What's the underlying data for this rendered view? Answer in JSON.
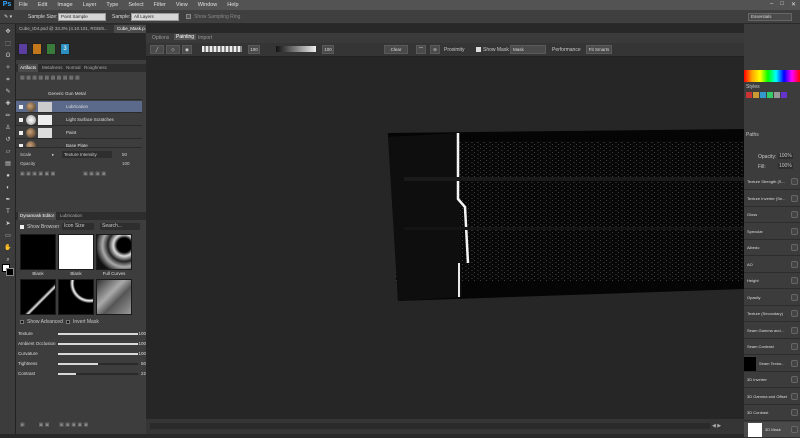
{
  "app": {
    "logo": "Ps"
  },
  "menu": [
    "File",
    "Edit",
    "Image",
    "Layer",
    "Type",
    "Select",
    "Filter",
    "View",
    "Window",
    "Help"
  ],
  "options": {
    "sample_size_label": "Sample Size:",
    "sample_size_value": "Point Sample",
    "sample_label": "Sample:",
    "sample_value": "All Layers",
    "show_ring": "Show Sampling Ring",
    "workspace": "Essentials"
  },
  "doc_tabs": [
    {
      "label": "Cube_ID4.psd @ 33.3% (4.10.101, RGB/8...",
      "active": false
    },
    {
      "label": "Cube_Mask.p...",
      "active": true
    }
  ],
  "ddo_top": {
    "tabs": [
      "Options",
      "Painting",
      "Import"
    ],
    "active": "Painting"
  },
  "ddo_bar": {
    "v1": "100",
    "v2": "100",
    "clear": "Clear",
    "proximity": "Proximity",
    "show_mask": "Show Mask",
    "mask": "Mask",
    "performance": "Performance",
    "fit_smarts": "Fit Smarts"
  },
  "left": {
    "tabs": [
      "Artifacts",
      "Metalness",
      "Normal",
      "Roughness"
    ],
    "layers": [
      {
        "label": "Generic Gun Metal"
      },
      {
        "label": "Lubrication"
      },
      {
        "label": "Light Surface Scratches"
      },
      {
        "label": "Paint"
      },
      {
        "label": "Base Plate"
      }
    ],
    "scale_label": "Scale",
    "scale_field": "Texture Intensity",
    "scale_val": "50",
    "opacity_label": "Opacity",
    "opacity_val": "100",
    "editor_tabs": [
      "Dynamask Editor",
      "Lubrication"
    ],
    "show_browser": "Show Browser",
    "icon_size": "Icon Size",
    "search": "Search...",
    "thumbs": [
      "Blank",
      "Blank",
      "Full Curves"
    ],
    "show_advanced": "Show Advanced",
    "invert_mask": "Invert Mask",
    "sliders": [
      {
        "label": "Texture",
        "value": 100,
        "display": "100"
      },
      {
        "label": "Ambient Occlusion",
        "value": 100,
        "display": "100"
      },
      {
        "label": "Curvature",
        "value": 100,
        "display": "100"
      },
      {
        "label": "Tightness",
        "value": 50,
        "display": "50"
      },
      {
        "label": "Contrast",
        "value": 22,
        "display": "22"
      }
    ]
  },
  "right": {
    "opacity_label": "Opacity:",
    "opacity_val": "100%",
    "fill_label": "Fill:",
    "fill_val": "100%",
    "styles_label": "Styles",
    "paths_label": "Paths",
    "layers": [
      "Texture Strength (S...",
      "Texture Inverter (Se...",
      "Gloss",
      "Specular",
      "Albedo",
      "AO",
      "Height",
      "Opacity",
      "Texture (Secondary)",
      "Seam Gamma and...",
      "Seam Contrast",
      "Seam Textur...",
      "3D Inverter",
      "3D Gamma and Offset",
      "3D Contrast",
      "3D Mask"
    ]
  },
  "colors": {
    "menubar": "#535353",
    "panel": "#3d3d3d",
    "canvas": "#262626",
    "accent": "#5b6a8a"
  }
}
